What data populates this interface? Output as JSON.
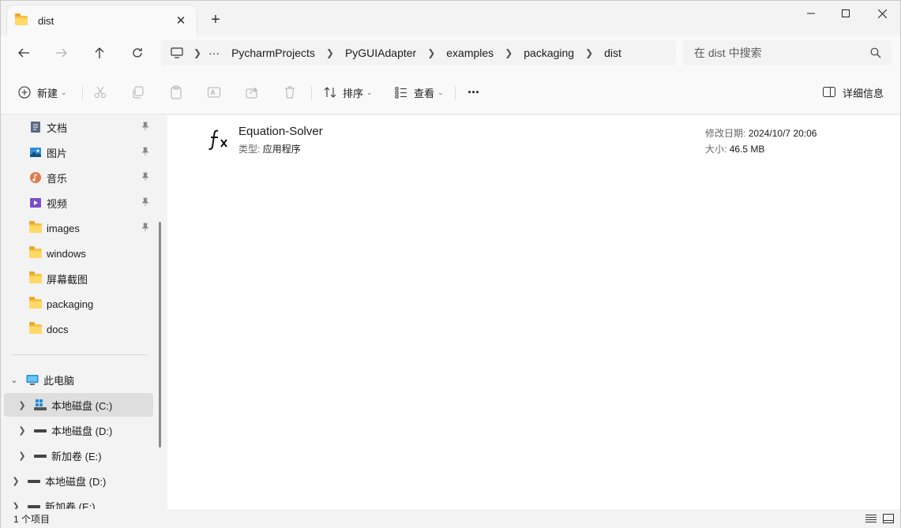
{
  "tab": {
    "title": "dist",
    "close_glyph": "✕",
    "new_glyph": "+"
  },
  "window": {
    "minimize_glyph": "—",
    "maximize_glyph": "☐",
    "close_glyph": "✕"
  },
  "nav": {
    "back_glyph": "←",
    "forward_glyph": "→",
    "up_glyph": "↑",
    "refresh_glyph": "↻"
  },
  "address": {
    "more_glyph": "···",
    "crumbs": [
      "PycharmProjects",
      "PyGUIAdapter",
      "examples",
      "packaging",
      "dist"
    ]
  },
  "search": {
    "placeholder": "在 dist 中搜索"
  },
  "toolbar": {
    "new_label": "新建",
    "sort_label": "排序",
    "view_label": "查看",
    "more_glyph": "···",
    "details_label": "详细信息"
  },
  "sidebar": {
    "quick": [
      {
        "label": "文档",
        "icon": "documents-icon",
        "pinned": true
      },
      {
        "label": "图片",
        "icon": "pictures-icon",
        "pinned": true
      },
      {
        "label": "音乐",
        "icon": "music-icon",
        "pinned": true
      },
      {
        "label": "视频",
        "icon": "videos-icon",
        "pinned": true
      },
      {
        "label": "images",
        "icon": "folder-icon",
        "pinned": true
      },
      {
        "label": "windows",
        "icon": "folder-icon",
        "pinned": false
      },
      {
        "label": "屏幕截图",
        "icon": "folder-icon",
        "pinned": false
      },
      {
        "label": "packaging",
        "icon": "folder-icon",
        "pinned": false
      },
      {
        "label": "docs",
        "icon": "folder-icon",
        "pinned": false
      }
    ],
    "this_pc": "此电脑",
    "drives": [
      {
        "label": "本地磁盘 (C:)",
        "icon": "windows-drive-icon",
        "selected": true
      },
      {
        "label": "本地磁盘 (D:)",
        "icon": "drive-icon",
        "selected": false
      },
      {
        "label": "新加卷 (E:)",
        "icon": "drive-icon",
        "selected": false
      }
    ],
    "other_drives": [
      {
        "label": "本地磁盘 (D:)",
        "icon": "drive-icon"
      },
      {
        "label": "新加卷 (E:)",
        "icon": "drive-icon"
      }
    ]
  },
  "file": {
    "name": "Equation-Solver",
    "type_key": "类型:",
    "type_value": "应用程序",
    "modified_key": "修改日期:",
    "modified_value": "2024/10/7 20:06",
    "size_key": "大小:",
    "size_value": "46.5 MB"
  },
  "status": {
    "item_count": "1 个项目"
  }
}
